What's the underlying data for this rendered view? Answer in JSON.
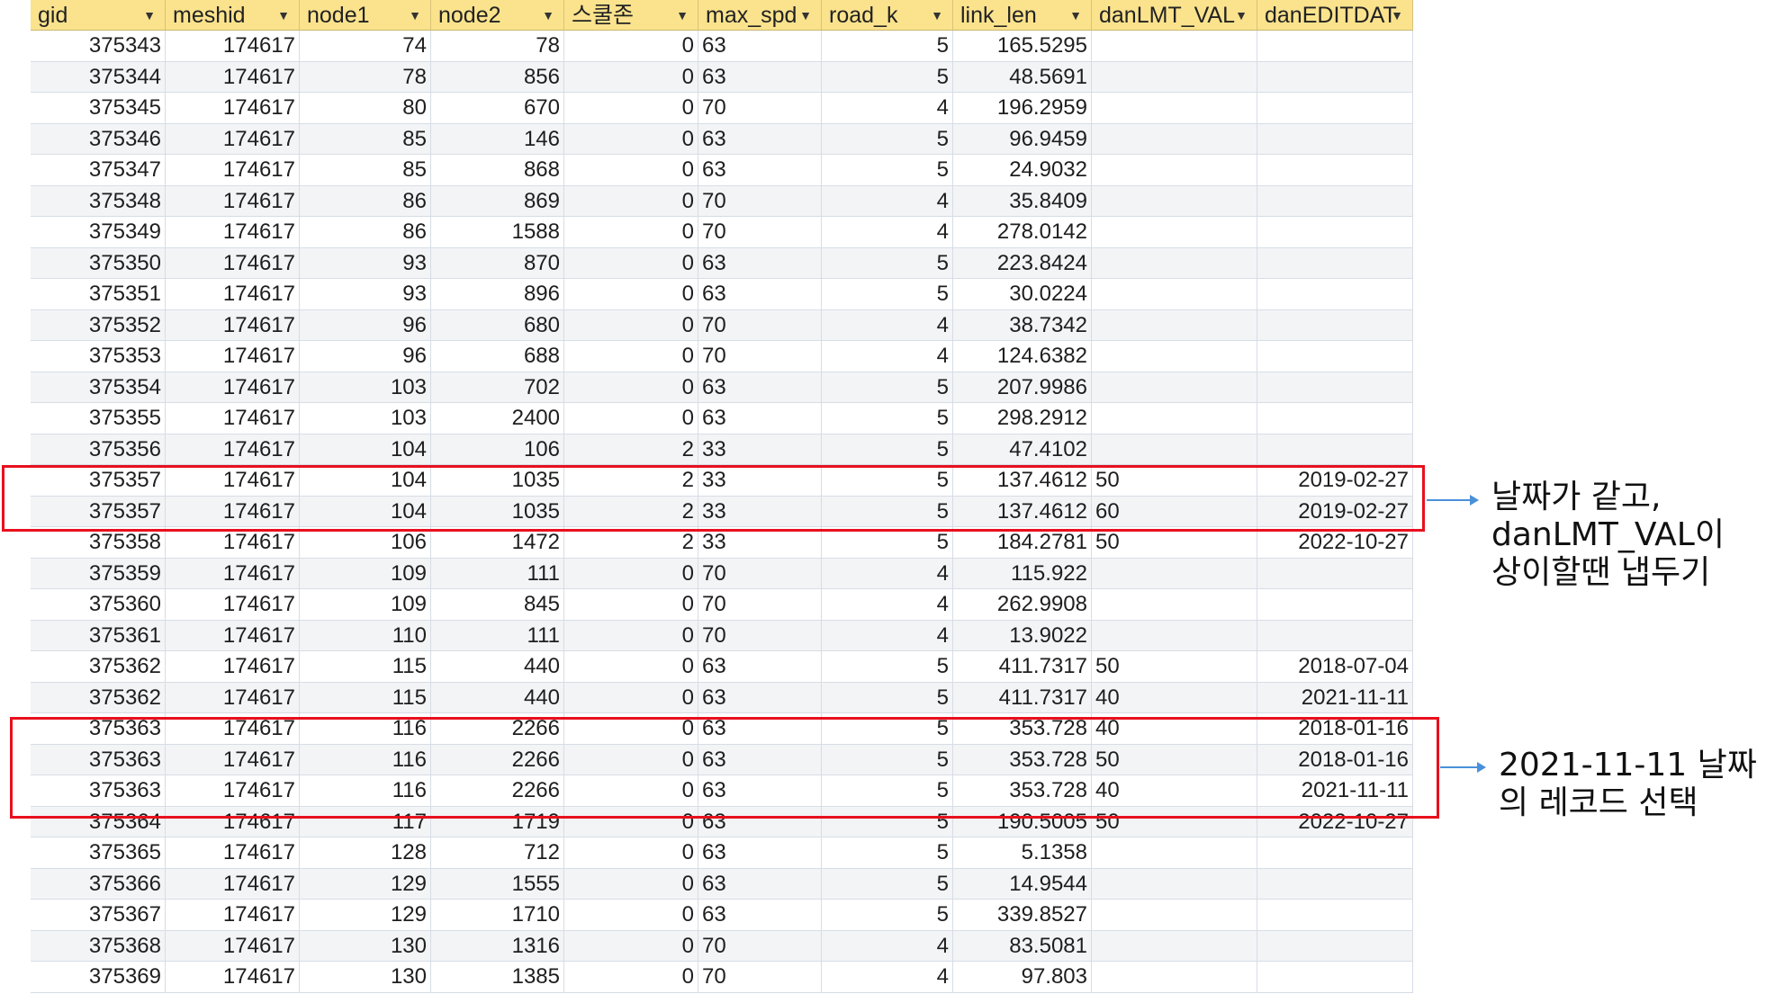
{
  "columns": [
    "gid",
    "meshid",
    "node1",
    "node2",
    "스쿨존",
    "max_spd",
    "road_k",
    "link_len",
    "danLMT_VAL",
    "danEDITDAT"
  ],
  "rows": [
    [
      "375343",
      "174617",
      "74",
      "78",
      "0",
      "63",
      "5",
      "165.5295",
      "",
      ""
    ],
    [
      "375344",
      "174617",
      "78",
      "856",
      "0",
      "63",
      "5",
      "48.5691",
      "",
      ""
    ],
    [
      "375345",
      "174617",
      "80",
      "670",
      "0",
      "70",
      "4",
      "196.2959",
      "",
      ""
    ],
    [
      "375346",
      "174617",
      "85",
      "146",
      "0",
      "63",
      "5",
      "96.9459",
      "",
      ""
    ],
    [
      "375347",
      "174617",
      "85",
      "868",
      "0",
      "63",
      "5",
      "24.9032",
      "",
      ""
    ],
    [
      "375348",
      "174617",
      "86",
      "869",
      "0",
      "70",
      "4",
      "35.8409",
      "",
      ""
    ],
    [
      "375349",
      "174617",
      "86",
      "1588",
      "0",
      "70",
      "4",
      "278.0142",
      "",
      ""
    ],
    [
      "375350",
      "174617",
      "93",
      "870",
      "0",
      "63",
      "5",
      "223.8424",
      "",
      ""
    ],
    [
      "375351",
      "174617",
      "93",
      "896",
      "0",
      "63",
      "5",
      "30.0224",
      "",
      ""
    ],
    [
      "375352",
      "174617",
      "96",
      "680",
      "0",
      "70",
      "4",
      "38.7342",
      "",
      ""
    ],
    [
      "375353",
      "174617",
      "96",
      "688",
      "0",
      "70",
      "4",
      "124.6382",
      "",
      ""
    ],
    [
      "375354",
      "174617",
      "103",
      "702",
      "0",
      "63",
      "5",
      "207.9986",
      "",
      ""
    ],
    [
      "375355",
      "174617",
      "103",
      "2400",
      "0",
      "63",
      "5",
      "298.2912",
      "",
      ""
    ],
    [
      "375356",
      "174617",
      "104",
      "106",
      "2",
      "33",
      "5",
      "47.4102",
      "",
      ""
    ],
    [
      "375357",
      "174617",
      "104",
      "1035",
      "2",
      "33",
      "5",
      "137.4612",
      "50",
      "2019-02-27"
    ],
    [
      "375357",
      "174617",
      "104",
      "1035",
      "2",
      "33",
      "5",
      "137.4612",
      "60",
      "2019-02-27"
    ],
    [
      "375358",
      "174617",
      "106",
      "1472",
      "2",
      "33",
      "5",
      "184.2781",
      "50",
      "2022-10-27"
    ],
    [
      "375359",
      "174617",
      "109",
      "111",
      "0",
      "70",
      "4",
      "115.922",
      "",
      ""
    ],
    [
      "375360",
      "174617",
      "109",
      "845",
      "0",
      "70",
      "4",
      "262.9908",
      "",
      ""
    ],
    [
      "375361",
      "174617",
      "110",
      "111",
      "0",
      "70",
      "4",
      "13.9022",
      "",
      ""
    ],
    [
      "375362",
      "174617",
      "115",
      "440",
      "0",
      "63",
      "5",
      "411.7317",
      "50",
      "2018-07-04"
    ],
    [
      "375362",
      "174617",
      "115",
      "440",
      "0",
      "63",
      "5",
      "411.7317",
      "40",
      "2021-11-11"
    ],
    [
      "375363",
      "174617",
      "116",
      "2266",
      "0",
      "63",
      "5",
      "353.728",
      "40",
      "2018-01-16"
    ],
    [
      "375363",
      "174617",
      "116",
      "2266",
      "0",
      "63",
      "5",
      "353.728",
      "50",
      "2018-01-16"
    ],
    [
      "375363",
      "174617",
      "116",
      "2266",
      "0",
      "63",
      "5",
      "353.728",
      "40",
      "2021-11-11"
    ],
    [
      "375364",
      "174617",
      "117",
      "1719",
      "0",
      "63",
      "5",
      "190.5005",
      "50",
      "2022-10-27"
    ],
    [
      "375365",
      "174617",
      "128",
      "712",
      "0",
      "63",
      "5",
      "5.1358",
      "",
      ""
    ],
    [
      "375366",
      "174617",
      "129",
      "1555",
      "0",
      "63",
      "5",
      "14.9544",
      "",
      ""
    ],
    [
      "375367",
      "174617",
      "129",
      "1710",
      "0",
      "63",
      "5",
      "339.8527",
      "",
      ""
    ],
    [
      "375368",
      "174617",
      "130",
      "1316",
      "0",
      "70",
      "4",
      "83.5081",
      "",
      ""
    ],
    [
      "375369",
      "174617",
      "130",
      "1385",
      "0",
      "70",
      "4",
      "97.803",
      "",
      ""
    ]
  ],
  "annotations": {
    "note1": [
      "날짜가 같고,",
      "danLMT_VAL이",
      "상이할땐 냅두기"
    ],
    "note2": [
      "2021-11-11 날짜",
      "의 레코드 선택"
    ]
  },
  "colors": {
    "header_bg": "#fbe38d",
    "highlight_border": "#e8101e",
    "arrow": "#4a90d9"
  }
}
